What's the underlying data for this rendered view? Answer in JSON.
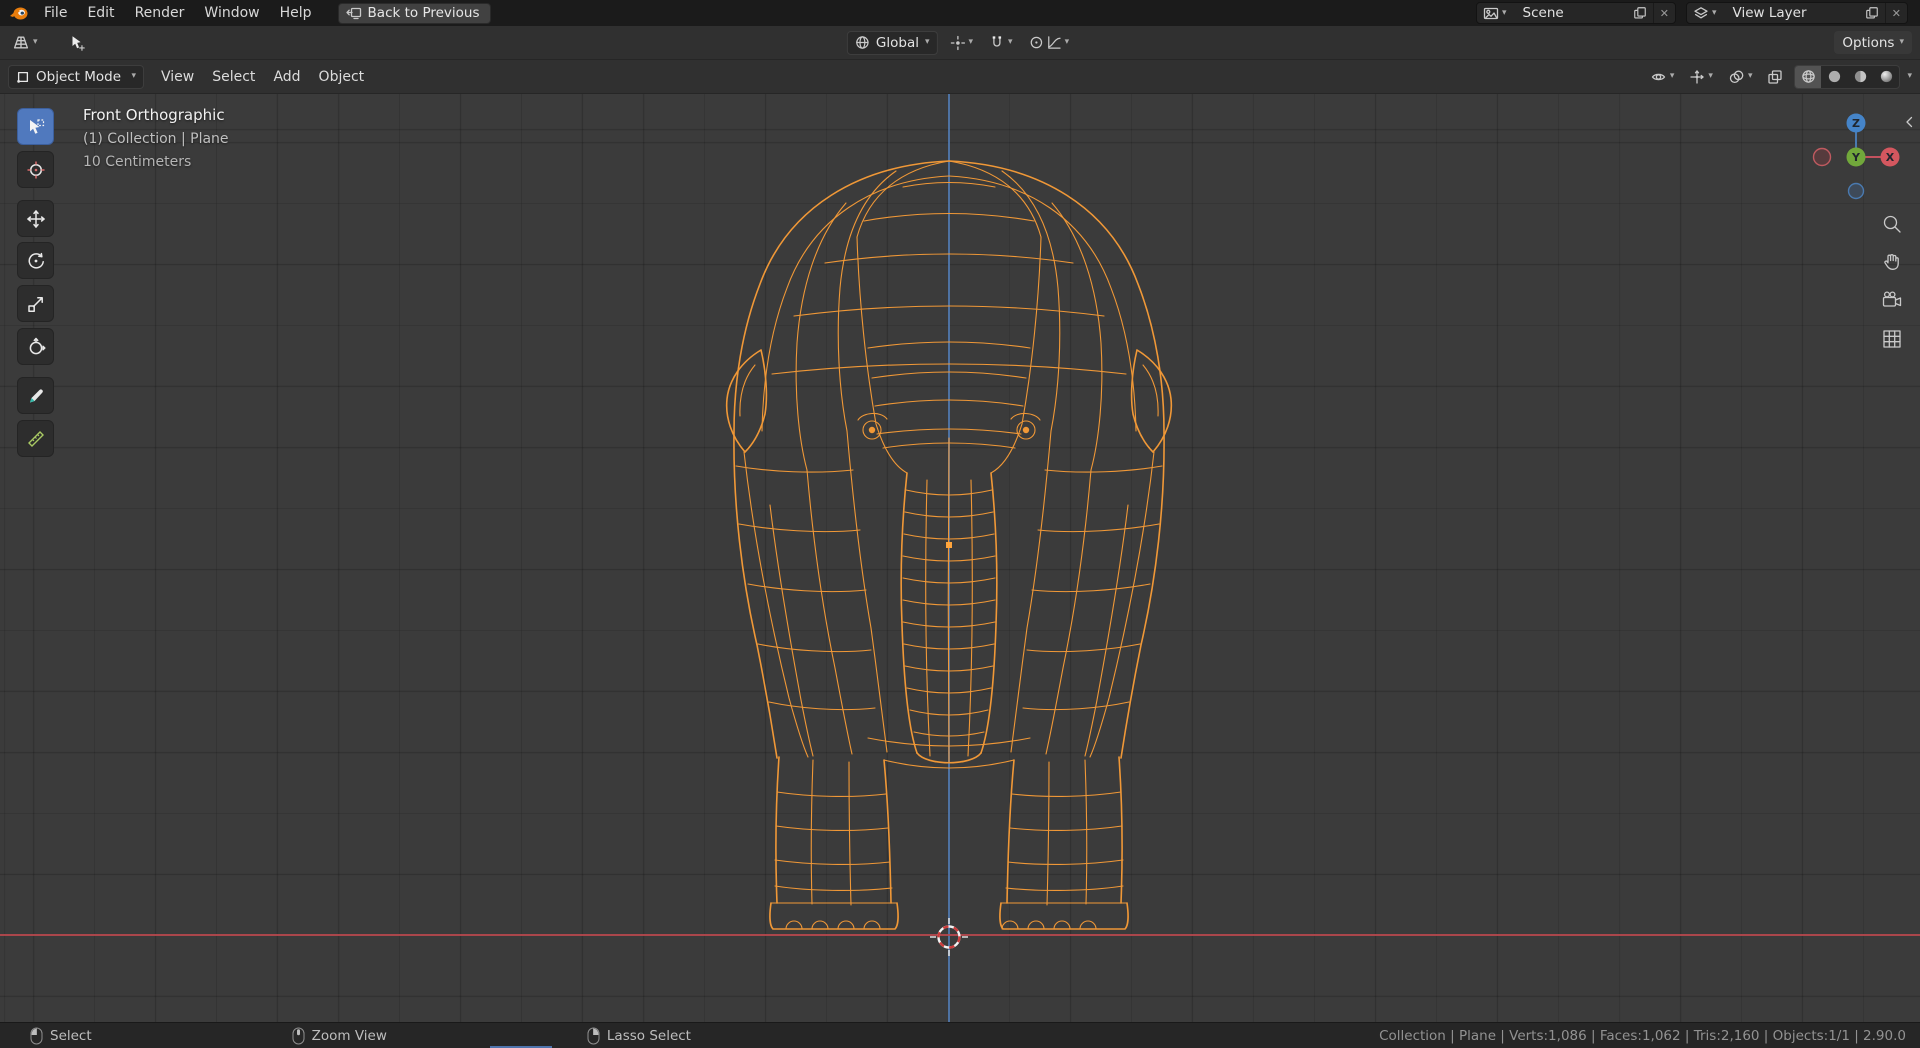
{
  "topbar": {
    "menus": [
      "File",
      "Edit",
      "Render",
      "Window",
      "Help"
    ],
    "back_button": "Back to Previous",
    "scene": {
      "value": "Scene"
    },
    "view_layer": {
      "value": "View Layer"
    }
  },
  "header": {
    "mode_select": "Object Mode",
    "menus": [
      "View",
      "Select",
      "Add",
      "Object"
    ],
    "orientation": "Global",
    "options_button": "Options"
  },
  "viewport": {
    "overlay": {
      "view_label": "Front Orthographic",
      "context_label": "(1) Collection | Plane",
      "scale_label": "10 Centimeters"
    },
    "gizmo": {
      "z": "Z",
      "y": "Y",
      "x": "X"
    }
  },
  "statusbar": {
    "hints": [
      "Select",
      "Zoom View",
      "Lasso Select"
    ],
    "stats": "Collection | Plane | Verts:1,086 | Faces:1,062 | Tris:2,160 | Objects:1/1 | 2.90.0"
  },
  "colors": {
    "wireframe": "#f09837",
    "axis-x": "#b8484e",
    "axis-z": "#527cb5",
    "accent": "#4f74ad"
  }
}
